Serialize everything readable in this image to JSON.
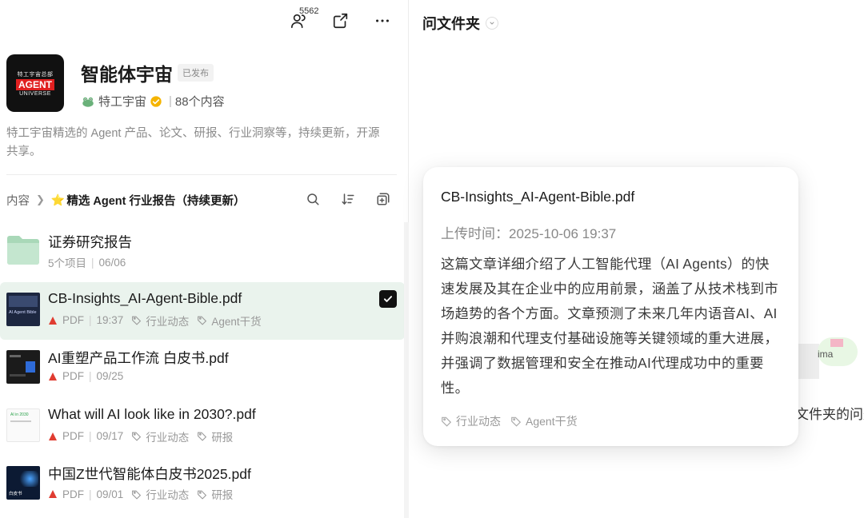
{
  "header": {
    "member_count": "5562",
    "icons": [
      "members-icon",
      "share-icon",
      "more-icon"
    ]
  },
  "kb": {
    "logo_line1": "特工宇宙总部",
    "logo_line2": "AGENT",
    "logo_line3": "UNIVERSE",
    "title": "智能体宇宙",
    "status": "已发布",
    "owner": "特工宇宙",
    "content_count": "88个内容",
    "description": "特工宇宙精选的 Agent 产品、论文、研报、行业洞察等，持续更新，开源共享。"
  },
  "breadcrumb": {
    "root": "内容",
    "star": "⭐",
    "current": "精选 Agent 行业报告（持续更新）"
  },
  "list": [
    {
      "name": "证券研究报告",
      "meta": "5个项目",
      "date": "06/06"
    },
    {
      "name": "CB-Insights_AI-Agent-Bible.pdf",
      "type": "PDF",
      "date": "19:37",
      "tags": [
        "行业动态",
        "Agent干货"
      ],
      "thumb_caption": "AI Agent Bible"
    },
    {
      "name": "AI重塑产品工作流 白皮书.pdf",
      "type": "PDF",
      "date": "09/25"
    },
    {
      "name": "What will AI look like in 2030?.pdf",
      "type": "PDF",
      "date": "09/17",
      "tags": [
        "行业动态",
        "研报"
      ],
      "thumb_caption": "AI in 2030"
    },
    {
      "name": "中国Z世代智能体白皮书2025.pdf",
      "type": "PDF",
      "date": "09/01",
      "tags": [
        "行业动态",
        "研报"
      ],
      "thumb_caption": "白皮书"
    }
  ],
  "right": {
    "ask_title": "问文件夹",
    "bg_ima": "ima",
    "bg_text": "文件夹的问题"
  },
  "card": {
    "title": "CB-Insights_AI-Agent-Bible.pdf",
    "time": "上传时间：2025-10-06 19:37",
    "body": "这篇文章详细介绍了人工智能代理（AI Agents）的快速发展及其在企业中的应用前景，涵盖了从技术栈到市场趋势的各个方面。文章预测了未来几年内语音AI、AI并购浪潮和代理支付基础设施等关键领域的重大进展，并强调了数据管理和安全在推动AI代理成功中的重要性。",
    "tags": [
      "行业动态",
      "Agent干货"
    ]
  },
  "colors": {
    "selected_row": "#eaf3ed",
    "pdf_red": "#e03c31",
    "verified_gold": "#f5b400",
    "folder_green": "#a9d8b8"
  }
}
